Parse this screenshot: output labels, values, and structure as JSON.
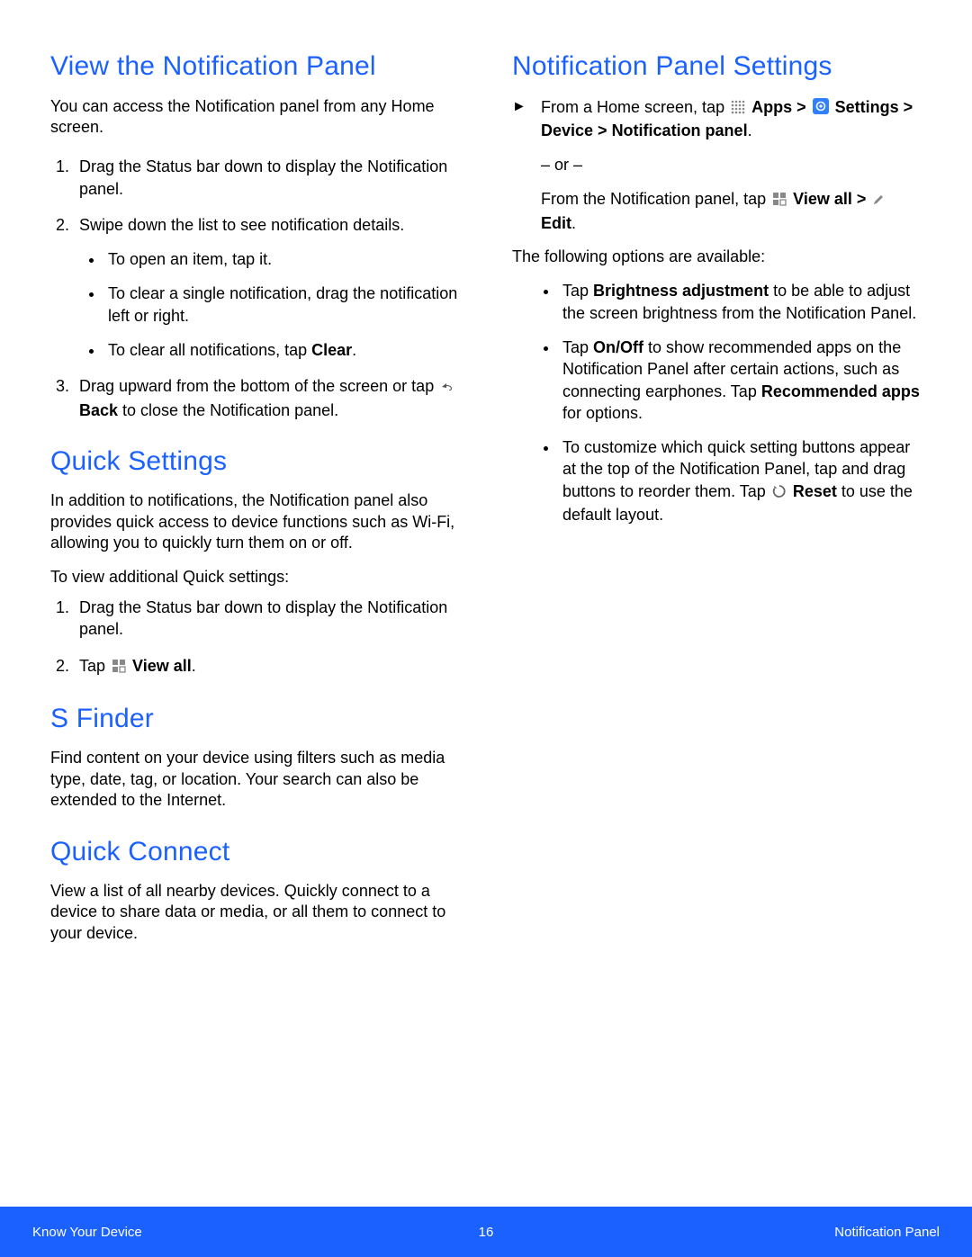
{
  "left": {
    "sec1": {
      "title": "View the Notification Panel",
      "intro": "You can access the Notification panel from any Home screen.",
      "step1": "Drag the Status bar down to display the Notification panel.",
      "step2": "Swipe down the list to see notification details.",
      "b1": "To open an item, tap it.",
      "b2": "To clear a single notification, drag the notification left or right.",
      "b3_pre": "To clear all notifications, tap ",
      "b3_bold": "Clear",
      "b3_post": ".",
      "step3_pre": "Drag upward from the bottom of the screen or tap ",
      "step3_bold": "Back",
      "step3_post": " to close the Notification panel."
    },
    "sec2": {
      "title": "Quick Settings",
      "p1": "In addition to notifications, the Notification panel also provides quick access to device functions such as Wi-Fi, allowing you to quickly turn them on or off.",
      "p2": "To view additional Quick settings:",
      "s1": "Drag the Status bar down to display the Notification panel.",
      "s2_pre": "Tap ",
      "s2_bold": "View all",
      "s2_post": "."
    },
    "sec3": {
      "title": "S Finder",
      "p": "Find content on your device using filters such as media type, date, tag, or location. Your search can also be extended to the Internet."
    },
    "sec4": {
      "title": "Quick Connect",
      "p": "View a list of all nearby devices. Quickly connect to a device to share data or media, or all them to connect to your device."
    }
  },
  "right": {
    "title": "Notification Panel Settings",
    "a1_pre": "From a Home screen, tap ",
    "a1_apps": "Apps",
    "a1_gt1": " > ",
    "a1_settings": "Settings",
    "a1_gt2": " > ",
    "a1_device": "Device",
    "a1_gt3": " > ",
    "a1_np": "Notification panel",
    "a1_post": ".",
    "or": "– or –",
    "a2_pre": "From the Notification panel, tap ",
    "a2_viewall": "View all",
    "a2_gt": " > ",
    "a2_edit": "Edit",
    "a2_post": ".",
    "p_opts": "The following options are available:",
    "b1_pre": "Tap ",
    "b1_bold": "Brightness adjustment",
    "b1_post": " to be able to adjust the screen brightness from the Notification Panel.",
    "b2_pre": "Tap ",
    "b2_bold1": "On/Off",
    "b2_mid": " to show recommended apps on the Notification Panel after certain actions, such as connecting earphones. Tap ",
    "b2_bold2": "Recommended apps",
    "b2_post": " for options.",
    "b3_pre": "To customize which quick setting buttons appear at the top of the Notification Panel, tap and drag buttons to reorder them. Tap ",
    "b3_bold": "Reset",
    "b3_post": " to use the default layout."
  },
  "footer": {
    "left": "Know Your Device",
    "page": "16",
    "right": "Notification Panel"
  }
}
